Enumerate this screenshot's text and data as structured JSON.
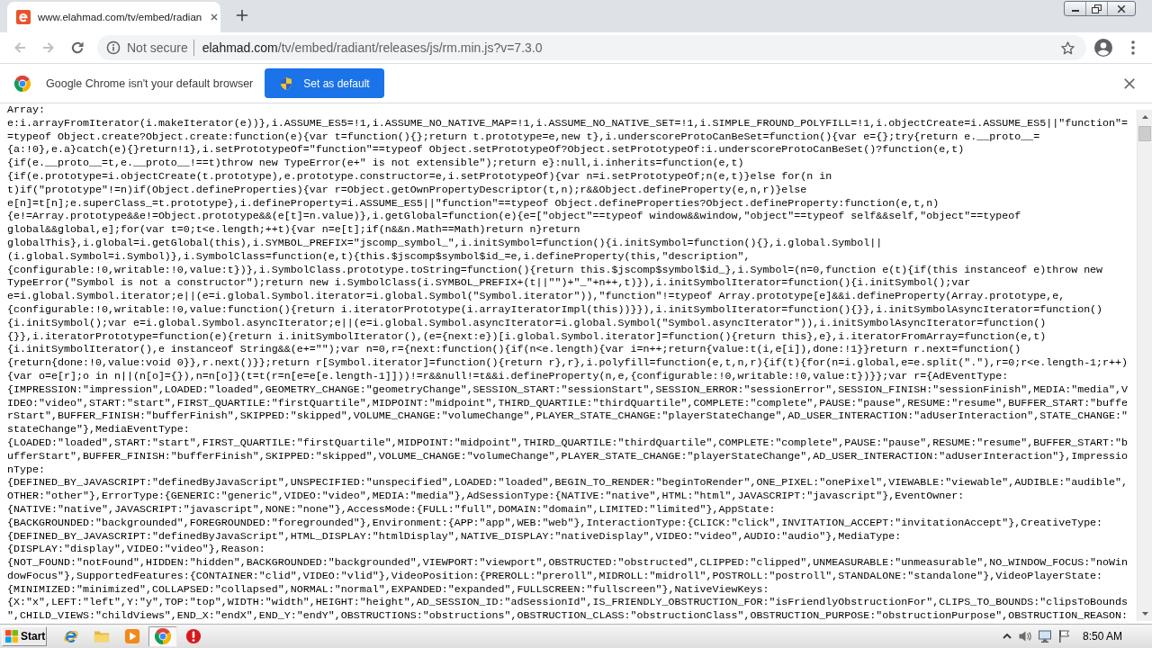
{
  "browser": {
    "tabs": [
      {
        "title": "www.elahmad.com/tv/embed/radian",
        "selected": true
      }
    ],
    "nav_buttons": [
      {
        "kind": "back",
        "disabled": true
      },
      {
        "kind": "forward",
        "disabled": true
      },
      {
        "kind": "reload",
        "disabled": false
      }
    ],
    "address_bar": {
      "security_label": "Not secure",
      "host": "elahmad.com",
      "path": "/tv/embed/radiant/releases/js/rm.min.js?v=7.3.0"
    }
  },
  "infobar": {
    "message": "Google Chrome isn't your default browser",
    "button": "Set as default"
  },
  "page": {
    "code_lines": [
      "Array:",
      "e:i.arrayFromIterator(i.makeIterator(e))},i.ASSUME_ES5=!1,i.ASSUME_NO_NATIVE_MAP=!1,i.ASSUME_NO_NATIVE_SET=!1,i.SIMPLE_FROUND_POLYFILL=!1,i.objectCreate=i.ASSUME_ES5||\"function\"=",
      "=typeof Object.create?Object.create:function(e){var t=function(){};return t.prototype=e,new t},i.underscoreProtoCanBeSet=function(){var e={};try{return e.__proto__=",
      "{a:!0},e.a}catch(e){}return!1},i.setPrototypeOf=\"function\"==typeof Object.setPrototypeOf?Object.setPrototypeOf:i.underscoreProtoCanBeSet()?function(e,t)",
      "{if(e.__proto__=t,e.__proto__!==t)throw new TypeError(e+\" is not extensible\");return e}:null,i.inherits=function(e,t)",
      "{if(e.prototype=i.objectCreate(t.prototype),e.prototype.constructor=e,i.setPrototypeOf){var n=i.setPrototypeOf;n(e,t)}else for(n in",
      "t)if(\"prototype\"!=n)if(Object.defineProperties){var r=Object.getOwnPropertyDescriptor(t,n);r&&Object.defineProperty(e,n,r)}else",
      "e[n]=t[n];e.superClass_=t.prototype},i.defineProperty=i.ASSUME_ES5||\"function\"==typeof Object.defineProperties?Object.defineProperty:function(e,t,n)",
      "{e!=Array.prototype&&e!=Object.prototype&&(e[t]=n.value)},i.getGlobal=function(e){e=[\"object\"==typeof window&&window,\"object\"==typeof self&&self,\"object\"==typeof",
      "global&&global,e];for(var t=0;t<e.length;++t){var n=e[t];if(n&&n.Math==Math)return n}return",
      "globalThis},i.global=i.getGlobal(this),i.SYMBOL_PREFIX=\"jscomp_symbol_\",i.initSymbol=function(){i.initSymbol=function(){},i.global.Symbol||",
      "(i.global.Symbol=i.Symbol)},i.SymbolClass=function(e,t){this.$jscomp$symbol$id_=e,i.defineProperty(this,\"description\",",
      "{configurable:!0,writable:!0,value:t})},i.SymbolClass.prototype.toString=function(){return this.$jscomp$symbol$id_},i.Symbol=(n=0,function e(t){if(this instanceof e)throw new",
      "TypeError(\"Symbol is not a constructor\");return new i.SymbolClass(i.SYMBOL_PREFIX+(t||\"\")+\"_\"+n++,t)}),i.initSymbolIterator=function(){i.initSymbol();var",
      "e=i.global.Symbol.iterator;e||(e=i.global.Symbol.iterator=i.global.Symbol(\"Symbol.iterator\")),\"function\"!=typeof Array.prototype[e]&&i.defineProperty(Array.prototype,e,",
      "{configurable:!0,writable:!0,value:function(){return i.iteratorPrototype(i.arrayIteratorImpl(this))}}),i.initSymbolIterator=function(){}},i.initSymbolAsyncIterator=function()",
      "{i.initSymbol();var e=i.global.Symbol.asyncIterator;e||(e=i.global.Symbol.asyncIterator=i.global.Symbol(\"Symbol.asyncIterator\")),i.initSymbolAsyncIterator=function()",
      "{}},i.iteratorPrototype=function(e){return i.initSymbolIterator(),(e={next:e})[i.global.Symbol.iterator]=function(){return this},e},i.iteratorFromArray=function(e,t)",
      "{i.initSymbolIterator(),e instanceof String&&(e+=\"\");var n=0,r={next:function(){if(n<e.length){var i=n++;return{value:t(i,e[i]),done:!1}}return r.next=function()",
      "{return{done:!0,value:void 0}},r.next()}};return r[Symbol.iterator]=function(){return r},r},i.polyfill=function(e,t,n,r){if(t){for(n=i.global,e=e.split(\".\"),r=0;r<e.length-1;r++)",
      "{var o=e[r];o in n||(n[o]={}),n=n[o]}(t=t(r=n[e=e[e.length-1]]))!=r&&null!=t&&i.defineProperty(n,e,{configurable:!0,writable:!0,value:t})}};var r={AdEventType:",
      "{IMPRESSION:\"impression\",LOADED:\"loaded\",GEOMETRY_CHANGE:\"geometryChange\",SESSION_START:\"sessionStart\",SESSION_ERROR:\"sessionError\",SESSION_FINISH:\"sessionFinish\",MEDIA:\"media\",V",
      "IDEO:\"video\",START:\"start\",FIRST_QUARTILE:\"firstQuartile\",MIDPOINT:\"midpoint\",THIRD_QUARTILE:\"thirdQuartile\",COMPLETE:\"complete\",PAUSE:\"pause\",RESUME:\"resume\",BUFFER_START:\"buffe",
      "rStart\",BUFFER_FINISH:\"bufferFinish\",SKIPPED:\"skipped\",VOLUME_CHANGE:\"volumeChange\",PLAYER_STATE_CHANGE:\"playerStateChange\",AD_USER_INTERACTION:\"adUserInteraction\",STATE_CHANGE:\"",
      "stateChange\"},MediaEventType:",
      "{LOADED:\"loaded\",START:\"start\",FIRST_QUARTILE:\"firstQuartile\",MIDPOINT:\"midpoint\",THIRD_QUARTILE:\"thirdQuartile\",COMPLETE:\"complete\",PAUSE:\"pause\",RESUME:\"resume\",BUFFER_START:\"b",
      "ufferStart\",BUFFER_FINISH:\"bufferFinish\",SKIPPED:\"skipped\",VOLUME_CHANGE:\"volumeChange\",PLAYER_STATE_CHANGE:\"playerStateChange\",AD_USER_INTERACTION:\"adUserInteraction\"},Impressio",
      "nType:",
      "{DEFINED_BY_JAVASCRIPT:\"definedByJavaScript\",UNSPECIFIED:\"unspecified\",LOADED:\"loaded\",BEGIN_TO_RENDER:\"beginToRender\",ONE_PIXEL:\"onePixel\",VIEWABLE:\"viewable\",AUDIBLE:\"audible\",",
      "OTHER:\"other\"},ErrorType:{GENERIC:\"generic\",VIDEO:\"video\",MEDIA:\"media\"},AdSessionType:{NATIVE:\"native\",HTML:\"html\",JAVASCRIPT:\"javascript\"},EventOwner:",
      "{NATIVE:\"native\",JAVASCRIPT:\"javascript\",NONE:\"none\"},AccessMode:{FULL:\"full\",DOMAIN:\"domain\",LIMITED:\"limited\"},AppState:",
      "{BACKGROUNDED:\"backgrounded\",FOREGROUNDED:\"foregrounded\"},Environment:{APP:\"app\",WEB:\"web\"},InteractionType:{CLICK:\"click\",INVITATION_ACCEPT:\"invitationAccept\"},CreativeType:",
      "{DEFINED_BY_JAVASCRIPT:\"definedByJavaScript\",HTML_DISPLAY:\"htmlDisplay\",NATIVE_DISPLAY:\"nativeDisplay\",VIDEO:\"video\",AUDIO:\"audio\"},MediaType:",
      "{DISPLAY:\"display\",VIDEO:\"video\"},Reason:",
      "{NOT_FOUND:\"notFound\",HIDDEN:\"hidden\",BACKGROUNDED:\"backgrounded\",VIEWPORT:\"viewport\",OBSTRUCTED:\"obstructed\",CLIPPED:\"clipped\",UNMEASURABLE:\"unmeasurable\",NO_WINDOW_FOCUS:\"noWin",
      "dowFocus\"},SupportedFeatures:{CONTAINER:\"clid\",VIDEO:\"vlid\"},VideoPosition:{PREROLL:\"preroll\",MIDROLL:\"midroll\",POSTROLL:\"postroll\",STANDALONE:\"standalone\"},VideoPlayerState:",
      "{MINIMIZED:\"minimized\",COLLAPSED:\"collapsed\",NORMAL:\"normal\",EXPANDED:\"expanded\",FULLSCREEN:\"fullscreen\"},NativeViewKeys:",
      "{X:\"x\",LEFT:\"left\",Y:\"y\",TOP:\"top\",WIDTH:\"width\",HEIGHT:\"height\",AD_SESSION_ID:\"adSessionId\",IS_FRIENDLY_OBSTRUCTION_FOR:\"isFriendlyObstructionFor\",CLIPS_TO_BOUNDS:\"clipsToBounds",
      "\",CHILD_VIEWS:\"childViews\",END_X:\"endX\",END_Y:\"endY\",OBSTRUCTIONS:\"obstructions\",OBSTRUCTION_CLASS:\"obstructionClass\",OBSTRUCTION_PURPOSE:\"obstructionPurpose\",OBSTRUCTION_REASON:"
    ]
  },
  "taskbar": {
    "start_label": "Start",
    "apps": [
      {
        "kind": "ie",
        "selected": false
      },
      {
        "kind": "folder",
        "selected": false
      },
      {
        "kind": "media",
        "selected": false
      },
      {
        "kind": "chrome",
        "selected": true
      },
      {
        "kind": "alert",
        "selected": false
      }
    ],
    "clock": "8:50 AM"
  }
}
